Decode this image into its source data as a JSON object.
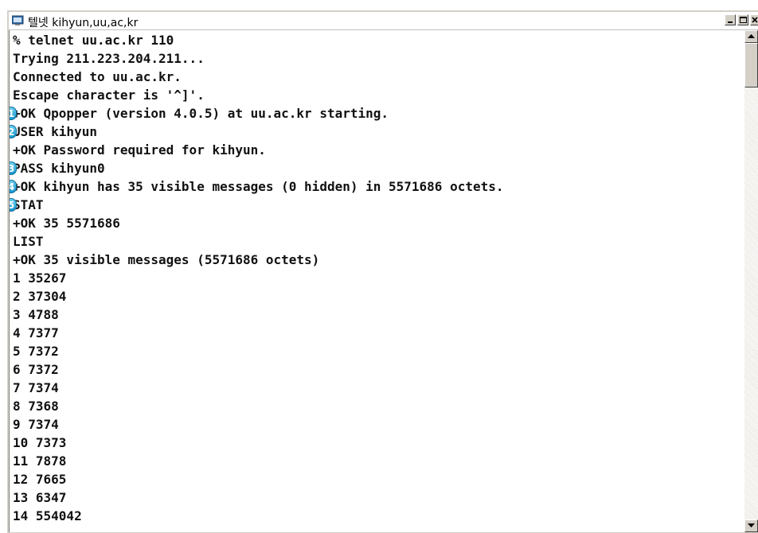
{
  "window": {
    "title": "텔넷 kihyun,uu,ac,kr"
  },
  "terminal": {
    "lines": [
      {
        "text": "% telnet uu.ac.kr 110",
        "marker": ""
      },
      {
        "text": "Trying 211.223.204.211...",
        "marker": ""
      },
      {
        "text": "Connected to uu.ac.kr.",
        "marker": ""
      },
      {
        "text": "Escape character is '^]'.",
        "marker": ""
      },
      {
        "text": "+OK Qpopper (version 4.0.5) at uu.ac.kr starting.",
        "marker": "1"
      },
      {
        "text": "USER kihyun",
        "marker": "2"
      },
      {
        "text": "+OK Password required for kihyun.",
        "marker": ""
      },
      {
        "text": "PASS kihyun0",
        "marker": "3"
      },
      {
        "text": "+OK kihyun has 35 visible messages (0 hidden) in 5571686 octets.",
        "marker": "4"
      },
      {
        "text": "STAT",
        "marker": "5"
      },
      {
        "text": "+OK 35 5571686",
        "marker": ""
      },
      {
        "text": "LIST",
        "marker": ""
      },
      {
        "text": "+OK 35 visible messages (5571686 octets)",
        "marker": ""
      },
      {
        "text": "1 35267",
        "marker": ""
      },
      {
        "text": "2 37304",
        "marker": ""
      },
      {
        "text": "3 4788",
        "marker": ""
      },
      {
        "text": "4 7377",
        "marker": ""
      },
      {
        "text": "5 7372",
        "marker": ""
      },
      {
        "text": "6 7372",
        "marker": ""
      },
      {
        "text": "7 7374",
        "marker": ""
      },
      {
        "text": "8 7368",
        "marker": ""
      },
      {
        "text": "9 7374",
        "marker": ""
      },
      {
        "text": "10 7373",
        "marker": ""
      },
      {
        "text": "11 7878",
        "marker": ""
      },
      {
        "text": "12 7665",
        "marker": ""
      },
      {
        "text": "13 6347",
        "marker": ""
      },
      {
        "text": "14 554042",
        "marker": ""
      }
    ]
  },
  "icons": {
    "app": "telnet-app-icon",
    "minimize": "minimize-icon",
    "maximize": "maximize-icon",
    "close": "close-icon",
    "scroll_up": "arrow-up-icon",
    "scroll_down": "arrow-down-icon"
  },
  "colors": {
    "marker": "#1796cc",
    "text": "#111111",
    "background": "#ffffff"
  }
}
